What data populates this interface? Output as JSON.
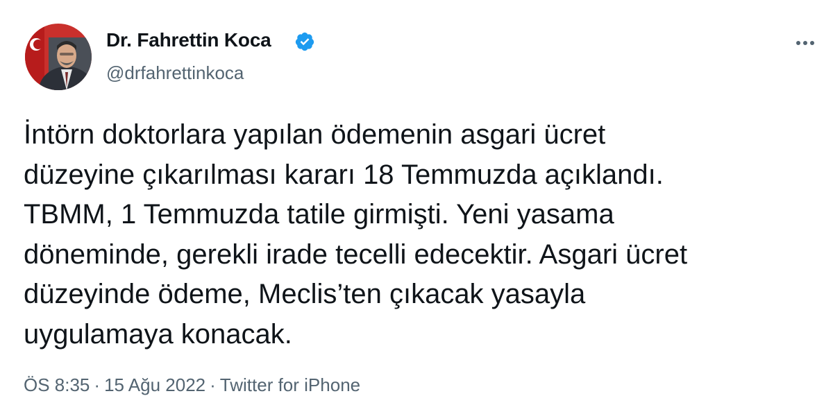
{
  "author": {
    "display_name": "Dr. Fahrettin Koca",
    "handle": "@drfahrettinkoca",
    "verified_icon": "verified-badge-icon",
    "avatar_icon": "profile-photo"
  },
  "menu": {
    "more_icon": "more-horizontal-icon"
  },
  "tweet": {
    "lines": [
      "İntörn doktorlara yapılan ödemenin asgari ücret",
      "düzeyine çıkarılması kararı 18 Temmuzda açıklandı.",
      "TBMM, 1 Temmuzda tatile girmişti. Yeni yasama",
      "döneminde, gerekli irade tecelli edecektir. Asgari ücret",
      "düzeyinde ödeme, Meclis’ten çıkacak yasayla",
      "uygulamaya konacak."
    ]
  },
  "meta": {
    "time": "ÖS 8:35",
    "separator": "·",
    "date": "15 Ağu 2022",
    "source": "Twitter for iPhone"
  },
  "colors": {
    "text": "#0f1419",
    "secondary": "#536471",
    "verified": "#1d9bf0"
  }
}
